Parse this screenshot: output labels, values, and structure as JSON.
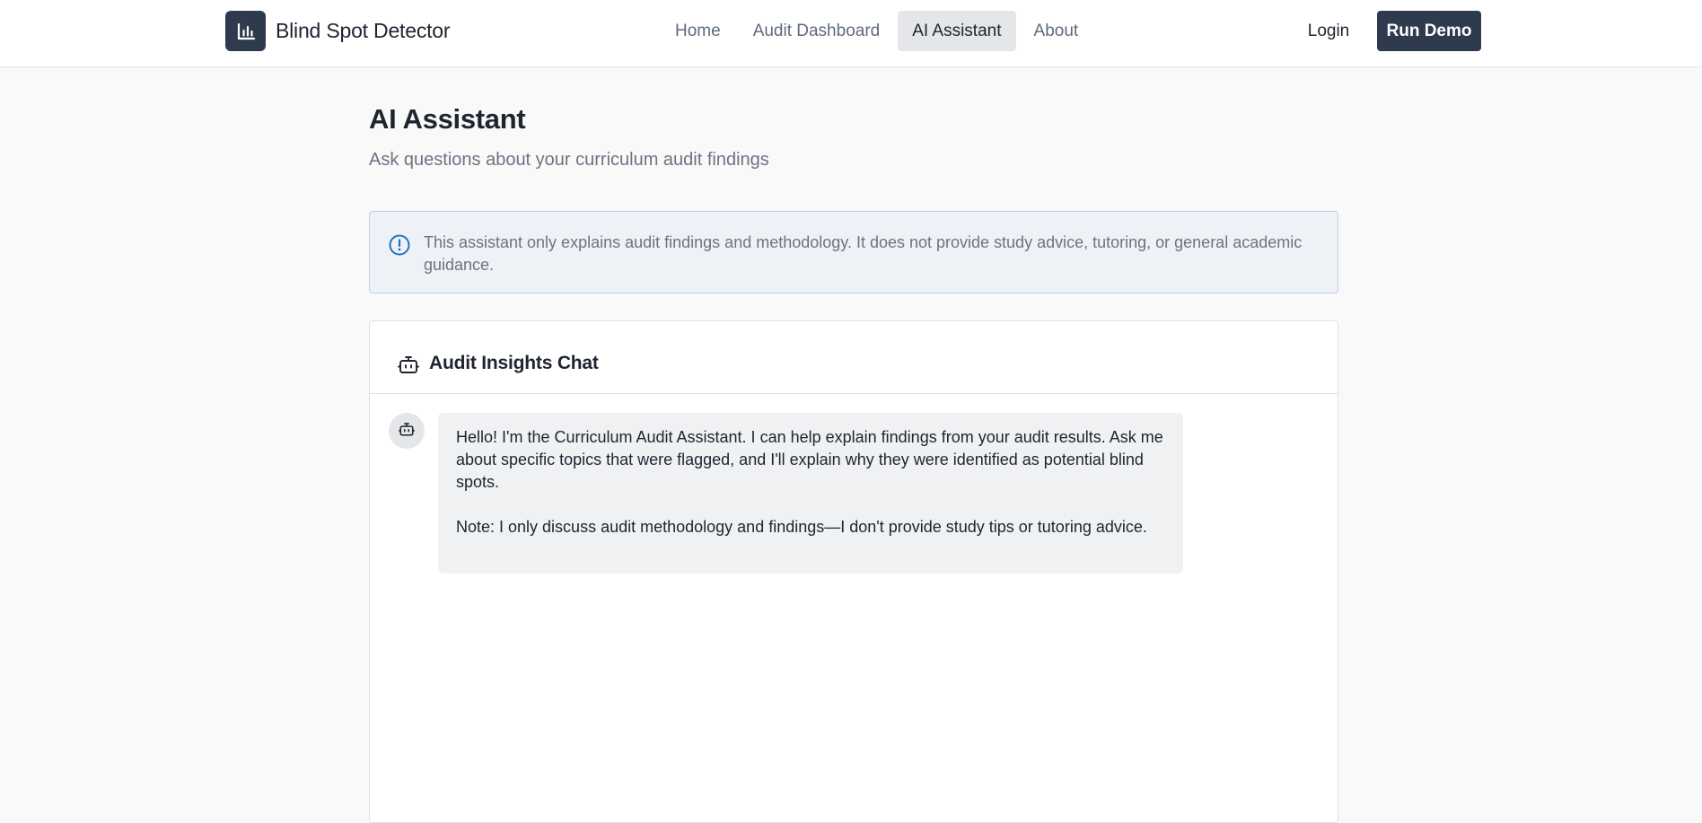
{
  "nav": {
    "brand": "Blind Spot Detector",
    "links": [
      "Home",
      "Audit Dashboard",
      "AI Assistant",
      "About"
    ],
    "active_link": "AI Assistant",
    "login_label": "Login",
    "demo_label": "Run Demo",
    "brand_icon": "bar-chart-icon"
  },
  "page": {
    "title": "AI Assistant",
    "subtitle": "Ask questions about your curriculum audit findings"
  },
  "notice": {
    "icon": "info-circle-icon",
    "text": "This assistant only explains audit findings and methodology. It does not provide study advice, tutoring, or general academic guidance."
  },
  "chat": {
    "title": "Audit Insights Chat",
    "header_icon": "bot-icon",
    "messages": [
      {
        "sender": "assistant",
        "avatar_icon": "bot-icon",
        "paragraphs": [
          "Hello! I'm the Curriculum Audit Assistant. I can help explain findings from your audit results. Ask me about specific topics that were flagged, and I'll explain why they were identified as potential blind spots.",
          "Note: I only discuss audit methodology and findings—I don't provide study tips or tutoring advice."
        ]
      }
    ]
  },
  "colors": {
    "primary": "#2e3a4d",
    "page_background": "#f9f9f9",
    "notice_background": "#eef2f6",
    "notice_border": "#b8d3ea",
    "info_accent": "#1f72c4",
    "bubble_background": "#f0f1f3",
    "muted_text": "#6a7482"
  }
}
